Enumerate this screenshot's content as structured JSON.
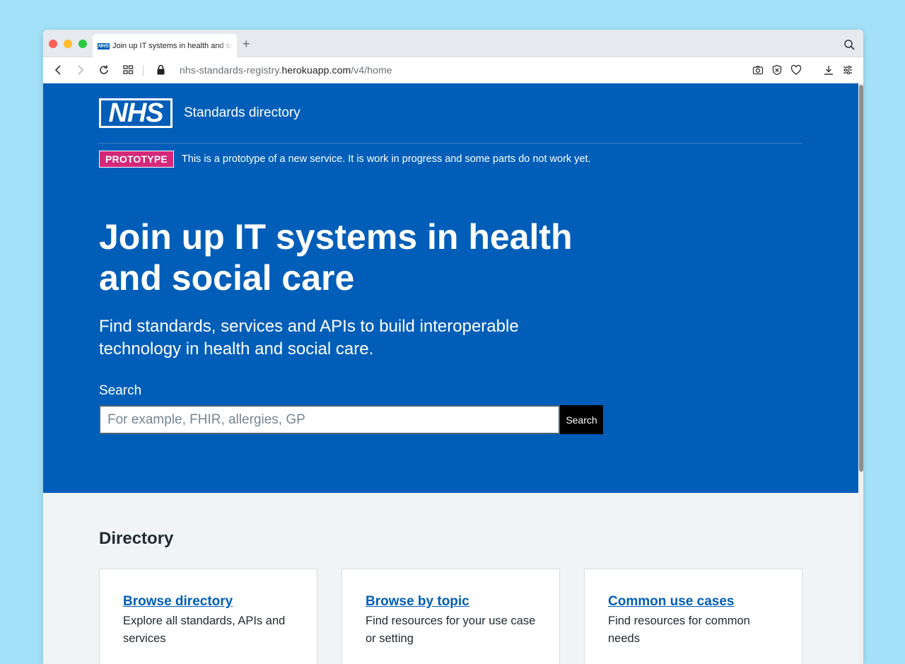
{
  "browser": {
    "tab": {
      "favicon_text": "NHS",
      "title": "Join up IT systems in health and social care"
    },
    "new_tab_symbol": "+",
    "url": {
      "prefix": "nhs-standards-registry.",
      "domain": "herokuapp.com",
      "path": "/v4/home"
    }
  },
  "header": {
    "logo_text": "NHS",
    "service_name": "Standards directory"
  },
  "phase_banner": {
    "tag": "PROTOTYPE",
    "text": "This is a prototype of a new service. It is work in progress and some parts do not work yet."
  },
  "hero": {
    "title": "Join up IT systems in health and social care",
    "lede": "Find standards, services and APIs to build interoperable technology in health and social care."
  },
  "search": {
    "label": "Search",
    "placeholder": "For example, FHIR, allergies, GP",
    "value": "",
    "button_label": "Search"
  },
  "directory": {
    "heading": "Directory",
    "cards": [
      {
        "title": "Browse directory",
        "description": "Explore all standards, APIs and services"
      },
      {
        "title": "Browse by topic",
        "description": "Find resources for your use case or setting"
      },
      {
        "title": "Common use cases",
        "description": "Find resources for common needs"
      }
    ]
  },
  "colors": {
    "nhs_blue": "#005eb8",
    "prototype_pink": "#d5287a",
    "page_background": "#f0f4f5",
    "desktop_background": "#a3e1f8"
  }
}
